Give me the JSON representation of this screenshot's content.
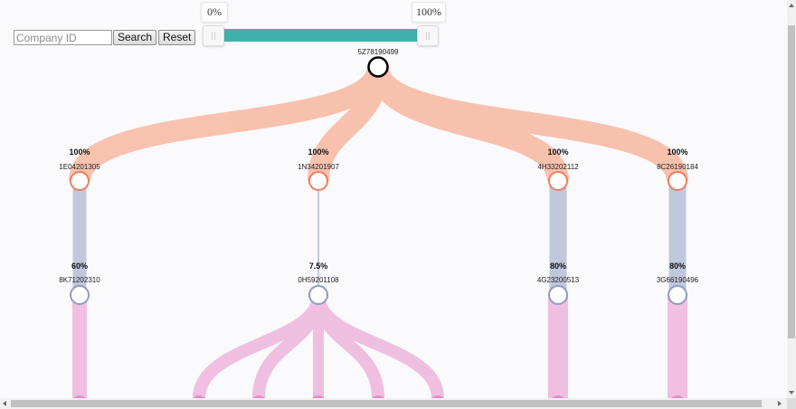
{
  "controls": {
    "company_input_placeholder": "Company ID",
    "search_label": "Search",
    "reset_label": "Reset"
  },
  "range_slider": {
    "min_label": "0%",
    "max_label": "100%",
    "min_value": 0,
    "max_value": 100
  },
  "colors": {
    "upper_link": "#f7a485",
    "middle_link": "#b4c0d6",
    "lower_link": "#eba7d6",
    "upper_node_stroke": "#f07d5b",
    "middle_node_stroke": "#8d9cc5",
    "lower_node_fill": "#e88bcb",
    "root_node_stroke": "#000000",
    "slider_fill": "#3eb2aa"
  },
  "root": {
    "id": "5Z78190499"
  },
  "level1": [
    {
      "id": "1E04201305",
      "percent": "100%"
    },
    {
      "id": "1N34201907",
      "percent": "100%"
    },
    {
      "id": "4H33202112",
      "percent": "100%"
    },
    {
      "id": "8C26190184",
      "percent": "100%"
    }
  ],
  "level2": [
    {
      "id": "8K71202310",
      "percent": "60%"
    },
    {
      "id": "0H59201108",
      "percent": "7.5%"
    },
    {
      "id": "4G23200513",
      "percent": "80%"
    },
    {
      "id": "3G66190496",
      "percent": "80%"
    }
  ]
}
